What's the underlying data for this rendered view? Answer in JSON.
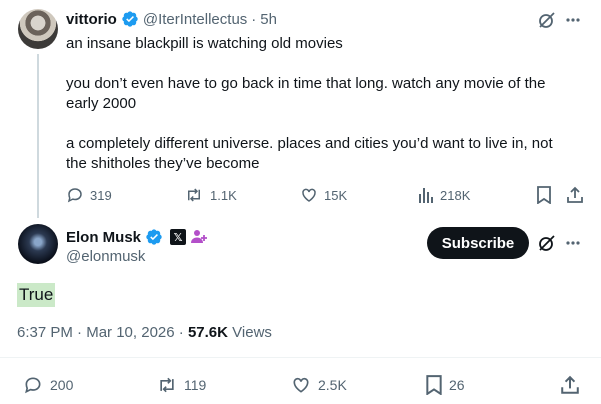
{
  "reply": {
    "display_name": "vittorio",
    "handle": "@IterIntellectus",
    "time": "5h",
    "paragraphs": [
      "an insane blackpill is watching old movies",
      "you don’t even have to go back in time that long. watch any movie of the early 2000",
      "a completely different universe. places and cities you’d want to live in, not the shitholes they’ve become"
    ],
    "actions": {
      "replies": "319",
      "reposts": "1.1K",
      "likes": "15K",
      "views": "218K"
    }
  },
  "main": {
    "display_name": "Elon Musk",
    "handle": "@elonmusk",
    "subscribe_label": "Subscribe",
    "text": "True",
    "time": "6:37 PM",
    "date": "Mar 10, 2026",
    "views_count": "57.6K",
    "views_label": "Views",
    "actions": {
      "replies": "200",
      "reposts": "119",
      "likes": "2.5K",
      "bookmarks": "26"
    }
  },
  "colors": {
    "verified_blue": "#1d9bf0",
    "text_primary": "#0f1419",
    "text_muted": "#536471",
    "highlight_green": "#cbe9c8",
    "badge_purple": "#b34fc9"
  },
  "icons": [
    "grok-icon",
    "more-icon",
    "reply-icon",
    "repost-icon",
    "like-icon",
    "views-icon",
    "bookmark-icon",
    "share-icon",
    "verified-icon",
    "x-affiliate-icon",
    "people-badge-icon"
  ]
}
